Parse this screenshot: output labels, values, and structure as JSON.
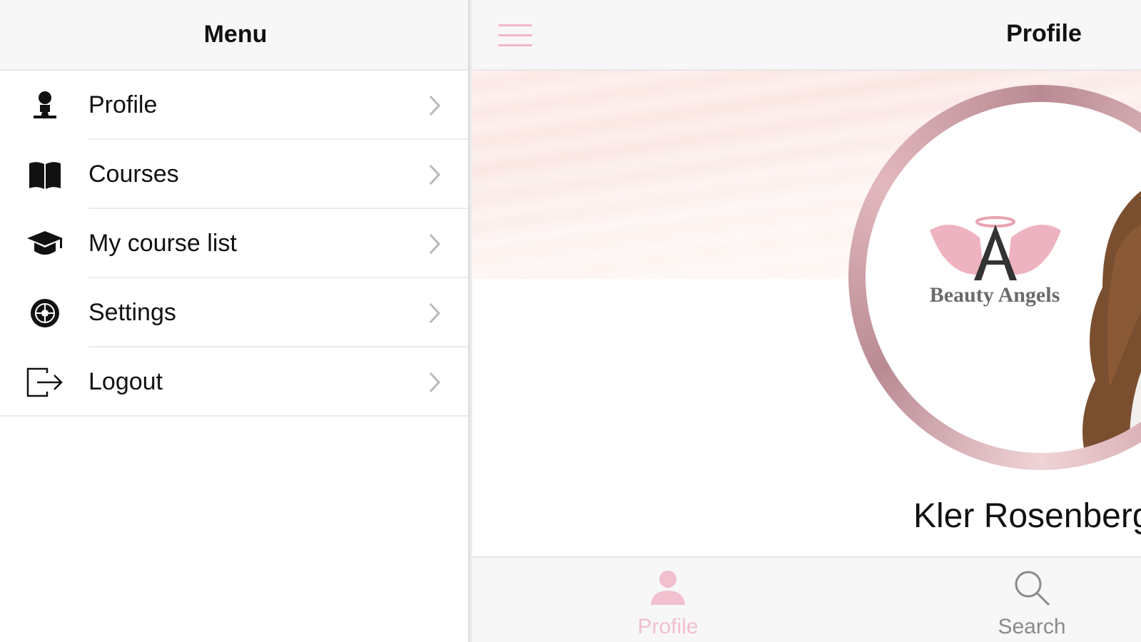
{
  "menu": {
    "title": "Menu",
    "items": [
      {
        "label": "Profile",
        "icon": "person-icon"
      },
      {
        "label": "Courses",
        "icon": "book-icon"
      },
      {
        "label": "My course list",
        "icon": "graduation-cap-icon"
      },
      {
        "label": "Settings",
        "icon": "gear-icon"
      },
      {
        "label": "Logout",
        "icon": "logout-icon"
      }
    ]
  },
  "main": {
    "title": "Profile",
    "hamburger_icon": "hamburger-icon",
    "profile": {
      "brand": "Beauty Angels",
      "name": "Kler Rosenberg"
    },
    "tabs": [
      {
        "label": "Profile",
        "icon": "person-icon",
        "active": true
      },
      {
        "label": "Search",
        "icon": "search-icon",
        "active": false
      }
    ]
  },
  "colors": {
    "accent_pink": "#f2bfce",
    "ring_rose": "#c9979f",
    "header_bg": "#f7f7f7"
  }
}
